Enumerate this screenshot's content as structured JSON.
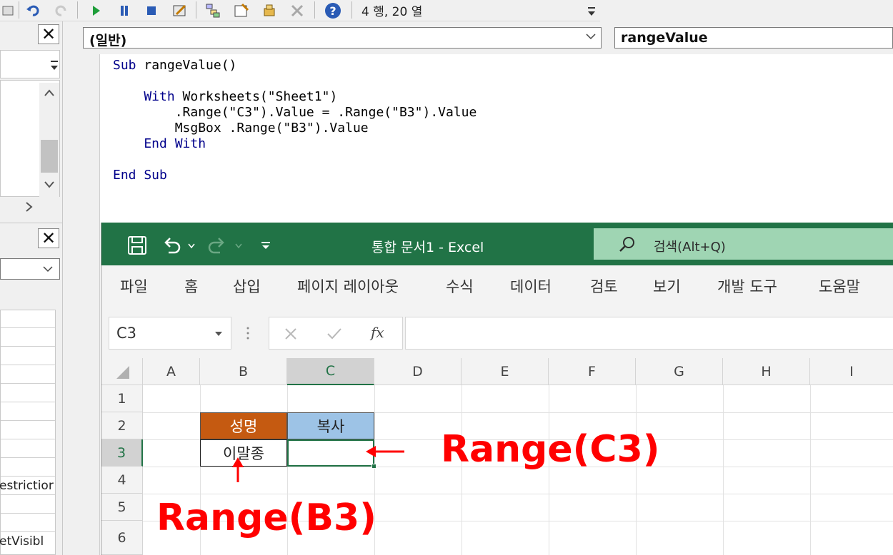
{
  "vbe": {
    "toolbar": {
      "status": "4 행, 20 열"
    },
    "code_header": {
      "object_combo": "(일반)",
      "proc_combo": "rangeValue"
    },
    "left_panel": {
      "frag1": "estrictior",
      "frag2": "etVisibl"
    },
    "code": {
      "l1a": "Sub",
      "l1b": " rangeValue()",
      "l3a": "    With",
      "l3b": " Worksheets(\"Sheet1\")",
      "l4": "        .Range(\"C3\").Value = .Range(\"B3\").Value",
      "l5": "        MsgBox .Range(\"B3\").Value",
      "l6a": "    End With",
      "l8a": "End Sub"
    }
  },
  "excel": {
    "title": "통합 문서1  -  Excel",
    "search_placeholder": "검색(Alt+Q)",
    "menu": [
      "파일",
      "홈",
      "삽입",
      "페이지 레이아웃",
      "수식",
      "데이터",
      "검토",
      "보기",
      "개발 도구",
      "도움말"
    ],
    "name_box": "C3",
    "fx_label": "fx",
    "columns": [
      "A",
      "B",
      "C",
      "D",
      "E",
      "F",
      "G",
      "H",
      "I"
    ],
    "rows": [
      "1",
      "2",
      "3",
      "4",
      "5",
      "6"
    ],
    "cells": {
      "B2": "성명",
      "C2": "복사",
      "B3": "이말종",
      "C3": ""
    },
    "colors": {
      "ribbon": "#217346",
      "b2_fill": "#c55a11",
      "c2_fill": "#9dc3e6",
      "annotation": "#ff0000"
    }
  },
  "annotations": {
    "c3_label": "Range(C3)",
    "b3_label": "Range(B3)"
  }
}
